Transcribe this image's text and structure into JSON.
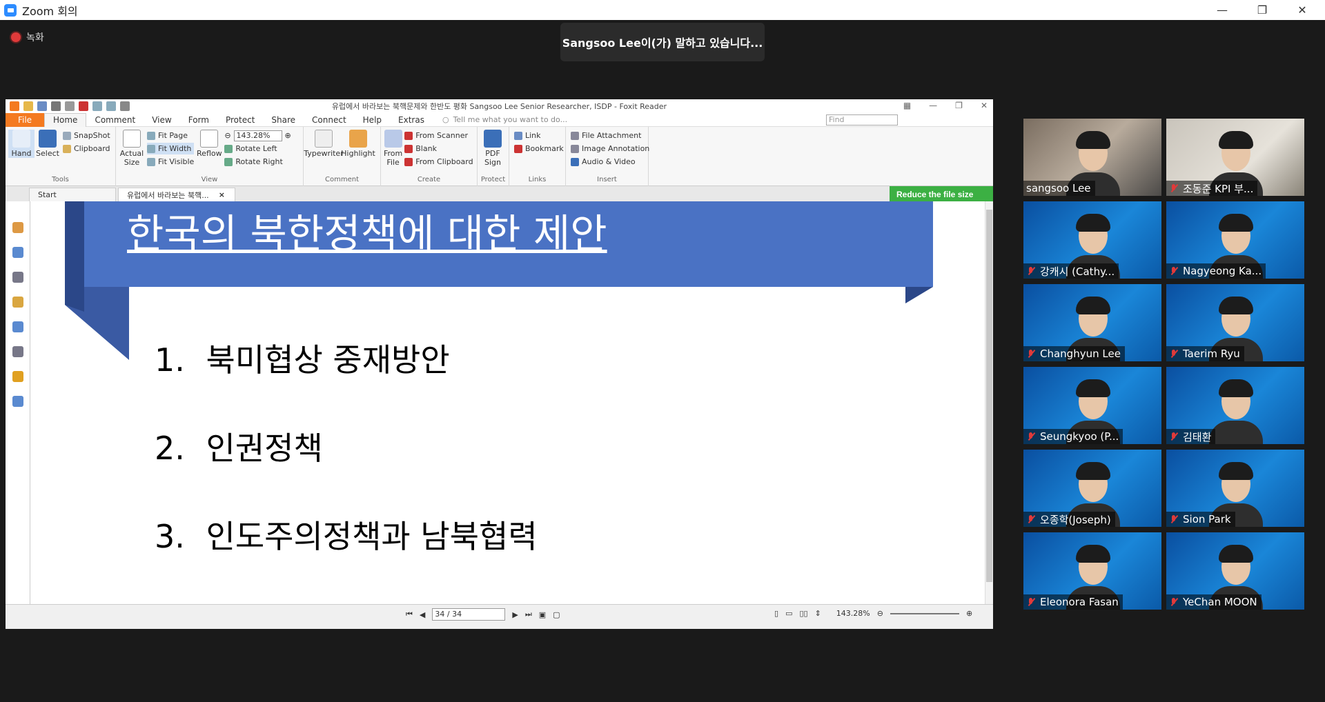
{
  "window": {
    "title": "Zoom 회의",
    "minimize": "—",
    "maximize": "❐",
    "close": "✕"
  },
  "recording": {
    "label": "녹화"
  },
  "speaker": {
    "text": "Sangsoo Lee이(가) 말하고 있습니다..."
  },
  "foxit": {
    "title": "유럽에서 바라보는 북핵문제와 한반도 평화  Sangsoo Lee Senior Researcher, ISDP - Foxit Reader",
    "menu": {
      "file": "File",
      "tabs": [
        "Home",
        "Comment",
        "View",
        "Form",
        "Protect",
        "Share",
        "Connect",
        "Help",
        "Extras"
      ],
      "tellme": "Tell me what you want to do...",
      "find_placeholder": "Find"
    },
    "ribbon": {
      "tools": {
        "hand": "Hand",
        "select": "Select",
        "snapshot": "SnapShot",
        "clipboard": "Clipboard",
        "label": "Tools"
      },
      "view": {
        "actual_size_1": "Actual",
        "actual_size_2": "Size",
        "fit_page": "Fit Page",
        "fit_width": "Fit Width",
        "fit_visible": "Fit Visible",
        "reflow": "Reflow",
        "zoom": "143.28%",
        "rotate_left": "Rotate Left",
        "rotate_right": "Rotate Right",
        "label": "View"
      },
      "comment": {
        "typewriter": "Typewriter",
        "highlight": "Highlight",
        "label": "Comment"
      },
      "create": {
        "from_file_1": "From",
        "from_file_2": "File",
        "from_scanner": "From Scanner",
        "blank": "Blank",
        "from_clipboard": "From Clipboard",
        "label": "Create"
      },
      "protect": {
        "pdf_sign_1": "PDF",
        "pdf_sign_2": "Sign",
        "label": "Protect"
      },
      "links": {
        "link": "Link",
        "bookmark": "Bookmark",
        "label": "Links"
      },
      "insert": {
        "file_attachment": "File Attachment",
        "image_annotation": "Image Annotation",
        "audio_video": "Audio & Video",
        "label": "Insert"
      }
    },
    "tabs": {
      "start": "Start",
      "doc": "유럽에서 바라보는 북핵...",
      "reduce": "Reduce the file size"
    },
    "slide": {
      "title": "한국의 북한정책에 대한 제안",
      "items": [
        {
          "num": "1.",
          "text": "북미협상 중재방안"
        },
        {
          "num": "2.",
          "text": "인권정책"
        },
        {
          "num": "3.",
          "text": "인도주의정책과 남북협력"
        }
      ]
    },
    "status": {
      "page": "34 / 34",
      "zoom": "143.28%"
    }
  },
  "participants": [
    {
      "name": "sangsoo Lee",
      "muted": false
    },
    {
      "name": "조동준 KPI 부...",
      "muted": true
    },
    {
      "name": "강캐시 (Cathy...",
      "muted": true
    },
    {
      "name": "Nagyeong Ka...",
      "muted": true
    },
    {
      "name": "Changhyun Lee",
      "muted": true
    },
    {
      "name": "Taerim Ryu",
      "muted": true
    },
    {
      "name": "Seungkyoo (P...",
      "muted": true
    },
    {
      "name": "김태환",
      "muted": true
    },
    {
      "name": "오종학(Joseph)",
      "muted": true
    },
    {
      "name": "Sion Park",
      "muted": true
    },
    {
      "name": "Eleonora Fasan",
      "muted": true
    },
    {
      "name": "YeChan MOON",
      "muted": true
    }
  ]
}
